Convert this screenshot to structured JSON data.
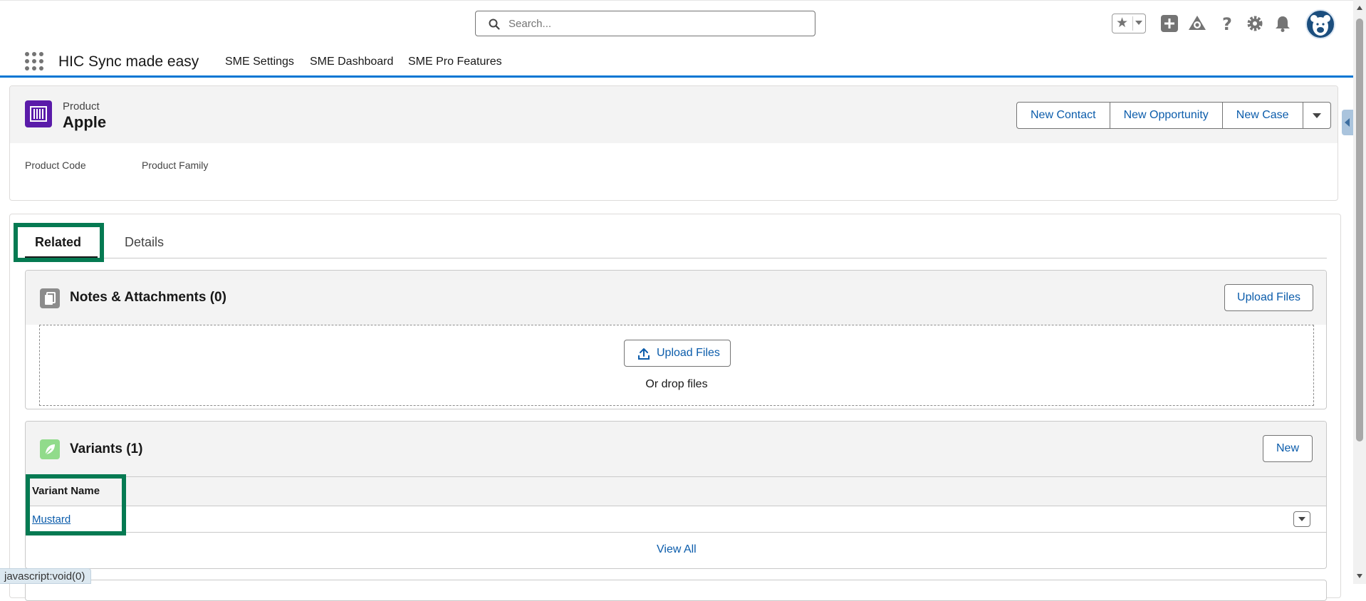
{
  "header": {
    "search_placeholder": "Search...",
    "icons": [
      "search-icon",
      "favorites-star-icon",
      "favorites-menu-icon",
      "global-actions-add-icon",
      "guidance-center-icon",
      "help-icon",
      "setup-gear-icon",
      "notifications-bell-icon",
      "user-avatar"
    ]
  },
  "nav": {
    "app_name": "HIC Sync made easy",
    "items": [
      "SME Settings",
      "SME Dashboard",
      "SME Pro Features"
    ]
  },
  "record": {
    "object_label": "Product",
    "name": "Apple",
    "actions": [
      "New Contact",
      "New Opportunity",
      "New Case"
    ],
    "fields": [
      "Product Code",
      "Product Family"
    ]
  },
  "tabs": [
    "Related",
    "Details"
  ],
  "notes": {
    "title": "Notes & Attachments (0)",
    "upload_button": "Upload Files",
    "drop_upload_button": "Upload Files",
    "drop_text": "Or drop files"
  },
  "variants": {
    "title": "Variants (1)",
    "new_button": "New",
    "column_header": "Variant Name",
    "rows": [
      "Mustard"
    ],
    "view_all": "View All"
  },
  "status_bar": "javascript:void(0)",
  "colors": {
    "brand_blue": "#0176d3",
    "link_blue": "#0b5cab",
    "product_icon": "#5a1ba9",
    "variants_icon": "#91db8b",
    "highlight_green": "#057a52"
  }
}
